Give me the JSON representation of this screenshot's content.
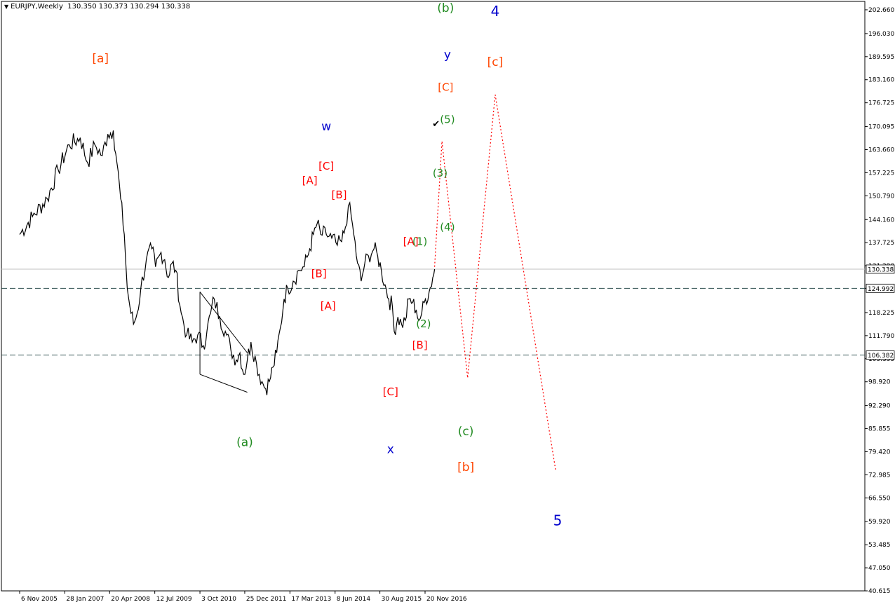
{
  "header": {
    "symbol": "EURJPY,Weekly",
    "ohlc": "130.350 130.373 130.294 130.338",
    "menu_icon": "triangle-down-icon"
  },
  "chart_data": {
    "type": "line",
    "background": "#ffffff",
    "price_color": "#000000",
    "ylim": [
      40.615,
      205.0
    ],
    "y_ticks": [
      "202.660",
      "196.030",
      "189.595",
      "183.160",
      "176.725",
      "170.095",
      "163.660",
      "157.225",
      "150.790",
      "144.160",
      "137.725",
      "131.290",
      "124.992",
      "118.225",
      "111.790",
      "105.355",
      "98.920",
      "92.290",
      "85.855",
      "79.420",
      "72.985",
      "66.550",
      "59.920",
      "53.485",
      "47.050",
      "40.615"
    ],
    "x_ticks": [
      "6 Nov 2005",
      "28 Jan 2007",
      "20 Apr 2008",
      "12 Jul 2009",
      "3 Oct 2010",
      "25 Dec 2011",
      "17 Mar 2013",
      "8 Jun 2014",
      "30 Aug 2015",
      "20 Nov 2016"
    ],
    "x_tick_years": [
      2005.85,
      2007.08,
      2008.3,
      2009.53,
      2010.76,
      2011.98,
      2013.21,
      2014.44,
      2015.66,
      2016.89
    ],
    "current_price": {
      "value": 130.338,
      "label": "130.338",
      "color": "#c0c0c0"
    },
    "levels": [
      {
        "value": 124.992,
        "label": "124.992",
        "style": "dashed",
        "color": "#2f4f4f"
      },
      {
        "value": 106.382,
        "label": "106.382",
        "style": "dashed",
        "color": "#2f4f4f"
      }
    ],
    "price_series": {
      "name": "EURJPY",
      "points": [
        [
          2005.85,
          140
        ],
        [
          2006.2,
          145
        ],
        [
          2006.6,
          150
        ],
        [
          2006.9,
          158
        ],
        [
          2007.2,
          165
        ],
        [
          2007.5,
          167
        ],
        [
          2007.7,
          160
        ],
        [
          2007.9,
          165
        ],
        [
          2008.1,
          162
        ],
        [
          2008.25,
          168
        ],
        [
          2008.4,
          169
        ],
        [
          2008.5,
          160
        ],
        [
          2008.6,
          150
        ],
        [
          2008.7,
          140
        ],
        [
          2008.78,
          125
        ],
        [
          2008.85,
          120
        ],
        [
          2008.95,
          115
        ],
        [
          2009.05,
          118
        ],
        [
          2009.15,
          125
        ],
        [
          2009.3,
          133
        ],
        [
          2009.45,
          136
        ],
        [
          2009.55,
          131
        ],
        [
          2009.7,
          135
        ],
        [
          2009.8,
          133
        ],
        [
          2009.9,
          128
        ],
        [
          2010.0,
          132
        ],
        [
          2010.1,
          130
        ],
        [
          2010.25,
          118
        ],
        [
          2010.4,
          112
        ],
        [
          2010.55,
          110
        ],
        [
          2010.7,
          112
        ],
        [
          2010.85,
          109
        ],
        [
          2010.95,
          113
        ],
        [
          2011.05,
          118
        ],
        [
          2011.15,
          122
        ],
        [
          2011.3,
          117
        ],
        [
          2011.45,
          113
        ],
        [
          2011.6,
          108
        ],
        [
          2011.75,
          105
        ],
        [
          2011.85,
          107
        ],
        [
          2011.95,
          101
        ],
        [
          2012.05,
          105
        ],
        [
          2012.15,
          110
        ],
        [
          2012.3,
          104
        ],
        [
          2012.45,
          99
        ],
        [
          2012.55,
          97
        ],
        [
          2012.65,
          99
        ],
        [
          2012.75,
          103
        ],
        [
          2012.85,
          107
        ],
        [
          2012.95,
          114
        ],
        [
          2013.05,
          122
        ],
        [
          2013.15,
          125
        ],
        [
          2013.3,
          127
        ],
        [
          2013.45,
          130
        ],
        [
          2013.6,
          131
        ],
        [
          2013.75,
          136
        ],
        [
          2013.85,
          140
        ],
        [
          2013.95,
          143
        ],
        [
          2014.05,
          140
        ],
        [
          2014.2,
          140
        ],
        [
          2014.35,
          139
        ],
        [
          2014.5,
          137
        ],
        [
          2014.62,
          138
        ],
        [
          2014.72,
          142
        ],
        [
          2014.8,
          148
        ],
        [
          2014.88,
          145
        ],
        [
          2014.95,
          140
        ],
        [
          2015.05,
          132
        ],
        [
          2015.15,
          127
        ],
        [
          2015.25,
          132
        ],
        [
          2015.35,
          134
        ],
        [
          2015.5,
          136
        ],
        [
          2015.6,
          134
        ],
        [
          2015.7,
          130
        ],
        [
          2015.8,
          126
        ],
        [
          2015.9,
          122
        ],
        [
          2016.0,
          120
        ],
        [
          2016.05,
          113
        ],
        [
          2016.15,
          117
        ],
        [
          2016.25,
          115
        ],
        [
          2016.35,
          116
        ],
        [
          2016.45,
          122
        ],
        [
          2016.55,
          121
        ],
        [
          2016.65,
          119
        ],
        [
          2016.72,
          116
        ],
        [
          2016.8,
          118
        ],
        [
          2016.9,
          122
        ],
        [
          2017.0,
          124
        ],
        [
          2017.1,
          128
        ],
        [
          2017.15,
          130.34
        ]
      ]
    },
    "triangle_lines": [
      [
        [
          2010.76,
          124
        ],
        [
          2012.05,
          107
        ]
      ],
      [
        [
          2010.76,
          101
        ],
        [
          2012.05,
          96
        ]
      ],
      [
        [
          2010.76,
          124
        ],
        [
          2010.76,
          101
        ]
      ]
    ],
    "projection": {
      "color": "#ff0000",
      "style": "dotted",
      "points": [
        [
          2017.15,
          131
        ],
        [
          2017.35,
          166
        ],
        [
          2018.05,
          100
        ],
        [
          2018.8,
          179
        ],
        [
          2020.45,
          74
        ]
      ]
    },
    "checkmark": {
      "x": 2017.2,
      "y": 171,
      "icon": "checkmark-icon"
    },
    "wave_labels": [
      {
        "text": "[a]",
        "x": 2008.05,
        "y": 189,
        "color": "#ff4500",
        "size": 17
      },
      {
        "text": "(b)",
        "x": 2017.45,
        "y": 203,
        "color": "#228b22",
        "size": 17
      },
      {
        "text": "4",
        "x": 2018.8,
        "y": 202,
        "color": "#0000cd",
        "size": 20
      },
      {
        "text": "y",
        "x": 2017.5,
        "y": 190,
        "color": "#0000cd",
        "size": 17
      },
      {
        "text": "[c]",
        "x": 2018.8,
        "y": 188,
        "color": "#ff4500",
        "size": 17
      },
      {
        "text": "[C]",
        "x": 2017.45,
        "y": 181,
        "color": "#ff4500",
        "size": 15
      },
      {
        "text": "(5)",
        "x": 2017.5,
        "y": 172,
        "color": "#228b22",
        "size": 15
      },
      {
        "text": "w",
        "x": 2014.2,
        "y": 170,
        "color": "#0000cd",
        "size": 17
      },
      {
        "text": "[A]",
        "x": 2013.75,
        "y": 155,
        "color": "#ff0000",
        "size": 15
      },
      {
        "text": "[C]",
        "x": 2014.2,
        "y": 159,
        "color": "#ff0000",
        "size": 15
      },
      {
        "text": "(3)",
        "x": 2017.3,
        "y": 157,
        "color": "#228b22",
        "size": 15
      },
      {
        "text": "[B]",
        "x": 2014.55,
        "y": 151,
        "color": "#ff0000",
        "size": 15
      },
      {
        "text": "(4)",
        "x": 2017.5,
        "y": 142,
        "color": "#228b22",
        "size": 15
      },
      {
        "text": "[A]",
        "x": 2016.5,
        "y": 138,
        "color": "#ff0000",
        "size": 15
      },
      {
        "text": "(1)",
        "x": 2016.75,
        "y": 138,
        "color": "#228b22",
        "size": 15
      },
      {
        "text": "[B]",
        "x": 2014.0,
        "y": 129,
        "color": "#ff0000",
        "size": 15
      },
      {
        "text": "[A]",
        "x": 2014.25,
        "y": 120,
        "color": "#ff0000",
        "size": 15
      },
      {
        "text": "(2)",
        "x": 2016.85,
        "y": 115,
        "color": "#228b22",
        "size": 15
      },
      {
        "text": "[B]",
        "x": 2016.75,
        "y": 109,
        "color": "#ff0000",
        "size": 15
      },
      {
        "text": "[C]",
        "x": 2015.95,
        "y": 96,
        "color": "#ff0000",
        "size": 15
      },
      {
        "text": "(a)",
        "x": 2011.98,
        "y": 82,
        "color": "#228b22",
        "size": 17
      },
      {
        "text": "(c)",
        "x": 2018.0,
        "y": 85,
        "color": "#228b22",
        "size": 17
      },
      {
        "text": "x",
        "x": 2015.95,
        "y": 80,
        "color": "#0000cd",
        "size": 17
      },
      {
        "text": "[b]",
        "x": 2018.0,
        "y": 75,
        "color": "#ff4500",
        "size": 17
      },
      {
        "text": "5",
        "x": 2020.5,
        "y": 60,
        "color": "#0000cd",
        "size": 20
      }
    ]
  }
}
